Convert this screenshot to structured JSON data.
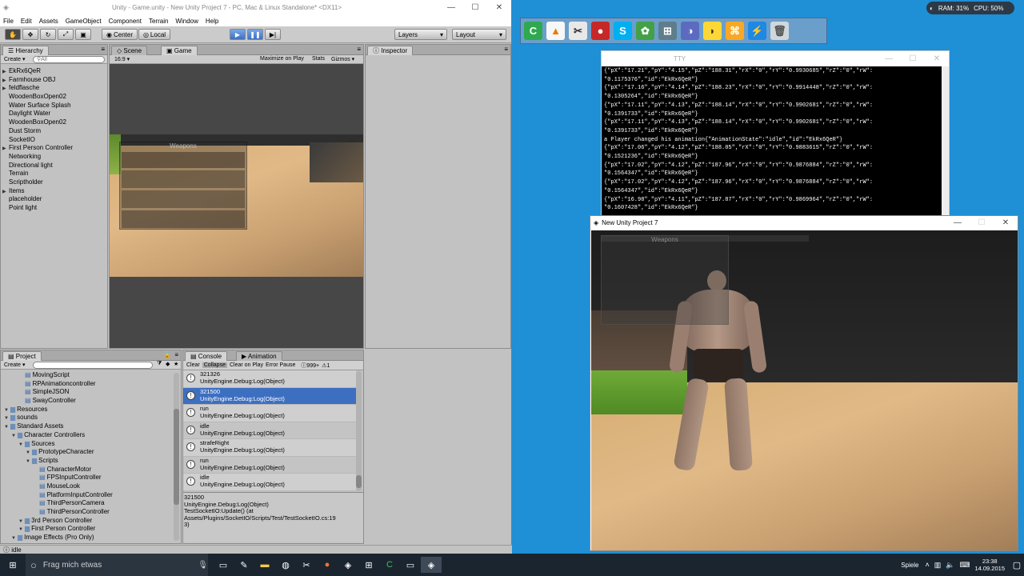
{
  "unity": {
    "title": "Unity - Game.unity - New Unity Project 7 - PC, Mac & Linux Standalone* <DX11>",
    "menu": [
      "File",
      "Edit",
      "Assets",
      "GameObject",
      "Component",
      "Terrain",
      "Window",
      "Help"
    ],
    "toolbar": {
      "center": "Center",
      "local": "Local",
      "layers": "Layers",
      "layout": "Layout"
    },
    "hierarchy": {
      "tab": "Hierarchy",
      "create": "Create",
      "search": "All",
      "items": [
        {
          "label": "EkRx6QeR",
          "arrow": true
        },
        {
          "label": "Farmhouse OBJ",
          "arrow": true
        },
        {
          "label": "feldflasche",
          "arrow": true
        },
        {
          "label": "WoodenBoxOpen02",
          "arrow": false
        },
        {
          "label": "Water Surface Splash",
          "arrow": false
        },
        {
          "label": "Daylight Water",
          "arrow": false
        },
        {
          "label": "WoodenBoxOpen02",
          "arrow": false
        },
        {
          "label": "Dust Storm",
          "arrow": false
        },
        {
          "label": "SocketIO",
          "arrow": false
        },
        {
          "label": "First Person Controller",
          "arrow": true
        },
        {
          "label": "Networking",
          "arrow": false
        },
        {
          "label": "Directional light",
          "arrow": false
        },
        {
          "label": "Terrain",
          "arrow": false
        },
        {
          "label": "Scriptholder",
          "arrow": false
        },
        {
          "label": "Items",
          "arrow": true
        },
        {
          "label": "placeholder",
          "arrow": false
        },
        {
          "label": "Point light",
          "arrow": false
        }
      ]
    },
    "scene_tab": "Scene",
    "game_tab": "Game",
    "game_bar": {
      "aspect": "16:9",
      "maximize": "Maximize on Play",
      "stats": "Stats",
      "gizmos": "Gizmos"
    },
    "inspector_tab": "Inspector",
    "game_overlay_title": "Weapons",
    "project": {
      "tab": "Project",
      "create": "Create",
      "items": [
        {
          "label": "MovingScript",
          "indent": 2,
          "arrow": false
        },
        {
          "label": "RPAnimationcontroller",
          "indent": 2,
          "arrow": false
        },
        {
          "label": "SimpleJSON",
          "indent": 2,
          "arrow": false
        },
        {
          "label": "SwayController",
          "indent": 2,
          "arrow": false
        },
        {
          "label": "Resources",
          "indent": 0,
          "arrow": true
        },
        {
          "label": "sounds",
          "indent": 0,
          "arrow": true
        },
        {
          "label": "Standard Assets",
          "indent": 0,
          "arrow": true
        },
        {
          "label": "Character Controllers",
          "indent": 1,
          "arrow": true
        },
        {
          "label": "Sources",
          "indent": 2,
          "arrow": true
        },
        {
          "label": "PrototypeCharacter",
          "indent": 3,
          "arrow": true
        },
        {
          "label": "Scripts",
          "indent": 3,
          "arrow": true
        },
        {
          "label": "CharacterMotor",
          "indent": 4,
          "arrow": false
        },
        {
          "label": "FPSInputController",
          "indent": 4,
          "arrow": false
        },
        {
          "label": "MouseLook",
          "indent": 4,
          "arrow": false
        },
        {
          "label": "PlatformInputController",
          "indent": 4,
          "arrow": false
        },
        {
          "label": "ThirdPersonCamera",
          "indent": 4,
          "arrow": false
        },
        {
          "label": "ThirdPersonController",
          "indent": 4,
          "arrow": false
        },
        {
          "label": "3rd Person Controller",
          "indent": 2,
          "arrow": true
        },
        {
          "label": "First Person Controller",
          "indent": 2,
          "arrow": true
        },
        {
          "label": "Image Effects (Pro Only)",
          "indent": 1,
          "arrow": true
        }
      ]
    },
    "console": {
      "tab": "Console",
      "anim_tab": "Animation",
      "buttons": {
        "clear": "Clear",
        "collapse": "Collapse",
        "clear_on_play": "Clear on Play",
        "error_pause": "Error Pause",
        "count": "999+",
        "warn": "1"
      },
      "rows": [
        {
          "msg": "321326",
          "src": "UnityEngine.Debug:Log(Object)",
          "sel": false
        },
        {
          "msg": "321500",
          "src": "UnityEngine.Debug:Log(Object)",
          "sel": true
        },
        {
          "msg": "run",
          "src": "UnityEngine.Debug:Log(Object)",
          "sel": false
        },
        {
          "msg": "idle",
          "src": "UnityEngine.Debug:Log(Object)",
          "sel": false
        },
        {
          "msg": "strafeRight",
          "src": "UnityEngine.Debug:Log(Object)",
          "sel": false
        },
        {
          "msg": "run",
          "src": "UnityEngine.Debug:Log(Object)",
          "sel": false
        },
        {
          "msg": "idle",
          "src": "UnityEngine.Debug:Log(Object)",
          "sel": false
        }
      ],
      "detail": "321500\nUnityEngine.Debug:Log(Object)\nTestSocketIO:Update() (at\nAssets/Plugins/SocketIO/Scripts/Test/TestSocketIO.cs:19\n3)"
    },
    "status": "idle"
  },
  "cmd": {
    "title": "TTY",
    "lines": [
      "{\"pX\":\"17.21\",\"pY\":\"4.15\",\"pZ\":\"188.31\",\"rX\":\"0\",\"rY\":\"0.9930685\",\"rZ\":\"0\",\"rW\":",
      "\"0.1175376\",\"id\":\"EkRx6QeR\"}",
      "{\"pX\":\"17.16\",\"pY\":\"4.14\",\"pZ\":\"188.23\",\"rX\":\"0\",\"rY\":\"0.9914448\",\"rZ\":\"0\",\"rW\":",
      "\"0.1305264\",\"id\":\"EkRx6QeR\"}",
      "{\"pX\":\"17.11\",\"pY\":\"4.13\",\"pZ\":\"188.14\",\"rX\":\"0\",\"rY\":\"0.9902681\",\"rZ\":\"0\",\"rW\":",
      "\"0.1391733\",\"id\":\"EkRx6QeR\"}",
      "{\"pX\":\"17.11\",\"pY\":\"4.13\",\"pZ\":\"188.14\",\"rX\":\"0\",\"rY\":\"0.9902681\",\"rZ\":\"0\",\"rW\":",
      "\"0.1391733\",\"id\":\"EkRx6QeR\"}",
      "a Player changed his animation{\"AnimationState\":\"idle\",\"id\":\"EkRx6QeR\"}",
      "{\"pX\":\"17.06\",\"pY\":\"4.12\",\"pZ\":\"188.05\",\"rX\":\"0\",\"rY\":\"0.9883615\",\"rZ\":\"0\",\"rW\":",
      "\"0.1521236\",\"id\":\"EkRx6QeR\"}",
      "{\"pX\":\"17.02\",\"pY\":\"4.12\",\"pZ\":\"187.96\",\"rX\":\"0\",\"rY\":\"0.9876884\",\"rZ\":\"0\",\"rW\":",
      "\"0.1564347\",\"id\":\"EkRx6QeR\"}",
      "{\"pX\":\"17.02\",\"pY\":\"4.12\",\"pZ\":\"187.96\",\"rX\":\"0\",\"rY\":\"0.9876884\",\"rZ\":\"0\",\"rW\":",
      "\"0.1564347\",\"id\":\"EkRx6QeR\"}",
      "{\"pX\":\"16.98\",\"pY\":\"4.11\",\"pZ\":\"187.87\",\"rX\":\"0\",\"rY\":\"0.9869964\",\"rZ\":\"0\",\"rW\":",
      "\"0.1607428\",\"id\":\"EkRx6QeR\"}"
    ]
  },
  "gamewin": {
    "title": "New Unity Project 7",
    "overlay_title": "Weapons"
  },
  "sysmon": {
    "ram": "RAM: 31%",
    "cpu": "CPU: 50%"
  },
  "taskbar": {
    "search": "Frag mich etwas",
    "tray_label": "Spiele",
    "time": "23:38",
    "date": "14.09.2015"
  },
  "colors": {
    "selection": "#3d6fc1",
    "desktop": "#1f8fd6",
    "taskbar": "#1b2530"
  }
}
